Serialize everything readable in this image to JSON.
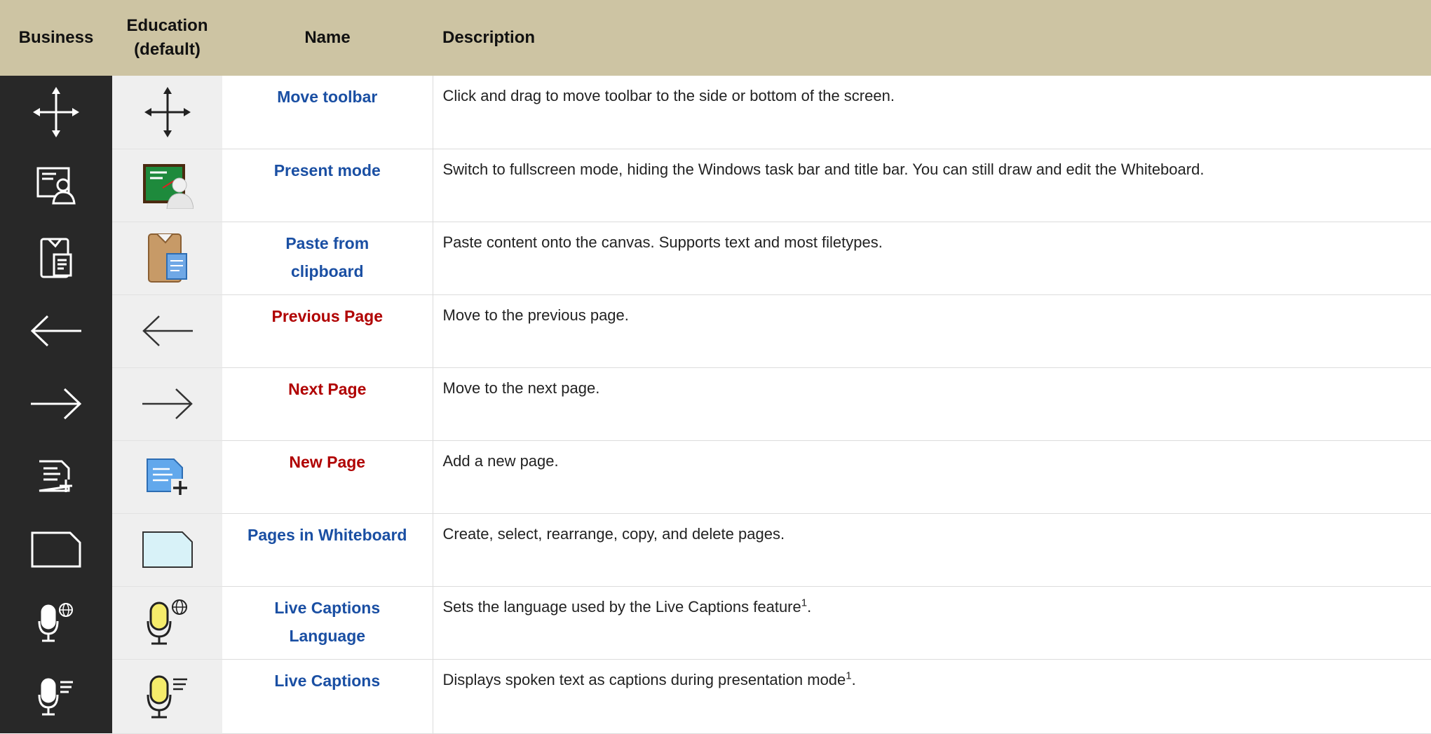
{
  "header": {
    "business": "Business",
    "education_line1": "Education",
    "education_line2": "(default)",
    "name": "Name",
    "description": "Description"
  },
  "colors": {
    "header_bg": "#cdc4a3",
    "business_col": "#282828",
    "education_col": "#efefef",
    "name_blue": "#1a4fa3",
    "name_red": "#b00000"
  },
  "rows": [
    {
      "icon": "move-icon",
      "name": "Move toolbar",
      "name_color": "blue",
      "description": "Click and drag to move toolbar to the side or bottom of the screen.",
      "sup": ""
    },
    {
      "icon": "present-mode-icon",
      "name": "Present mode",
      "name_color": "blue",
      "description": "Switch to fullscreen mode, hiding the Windows task bar and title bar. You can still draw and edit the Whiteboard.",
      "sup": ""
    },
    {
      "icon": "clipboard-icon",
      "name_line1": "Paste from",
      "name_line2": "clipboard",
      "name_color": "blue",
      "description": "Paste content onto the canvas. Supports text and most filetypes.",
      "sup": ""
    },
    {
      "icon": "arrow-left-icon",
      "name": "Previous Page",
      "name_color": "red",
      "description": "Move to the previous page.",
      "sup": ""
    },
    {
      "icon": "arrow-right-icon",
      "name": "Next Page",
      "name_color": "red",
      "description": "Move to the next page.",
      "sup": ""
    },
    {
      "icon": "new-page-icon",
      "name": "New Page",
      "name_color": "red",
      "description": "Add a new page.",
      "sup": ""
    },
    {
      "icon": "pages-icon",
      "name": "Pages in Whiteboard",
      "name_color": "blue",
      "description": "Create, select, rearrange, copy, and delete pages.",
      "sup": ""
    },
    {
      "icon": "microphone-globe-icon",
      "name_line1": "Live Captions",
      "name_line2": "Language",
      "name_color": "blue",
      "description": "Sets the language used by the Live Captions feature",
      "sup": "1"
    },
    {
      "icon": "microphone-captions-icon",
      "name": "Live Captions",
      "name_color": "blue",
      "description": "Displays spoken text as captions during presentation mode",
      "sup": "1"
    }
  ]
}
